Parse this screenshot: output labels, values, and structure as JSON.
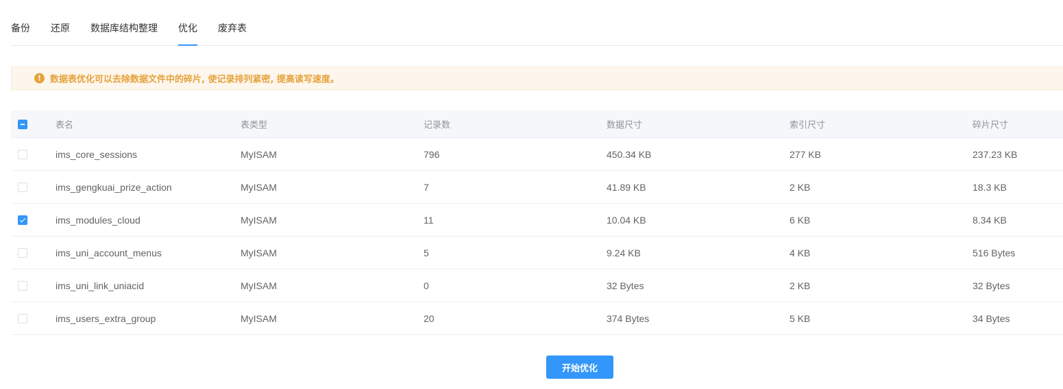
{
  "tabs": [
    {
      "label": "备份"
    },
    {
      "label": "还原"
    },
    {
      "label": "数据库结构整理"
    },
    {
      "label": "优化",
      "active": true
    },
    {
      "label": "废弃表"
    }
  ],
  "alert": {
    "icon": "!",
    "text": "数据表优化可以去除数据文件中的碎片, 使记录排列紧密, 提高读写速度。"
  },
  "table": {
    "columns": [
      "表名",
      "表类型",
      "记录数",
      "数据尺寸",
      "索引尺寸",
      "碎片尺寸"
    ],
    "rows": [
      {
        "name": "ims_core_sessions",
        "type": "MyISAM",
        "records": "796",
        "data_size": "450.34 KB",
        "index_size": "277 KB",
        "fragment_size": "237.23 KB",
        "checked": false
      },
      {
        "name": "ims_gengkuai_prize_action",
        "type": "MyISAM",
        "records": "7",
        "data_size": "41.89 KB",
        "index_size": "2 KB",
        "fragment_size": "18.3 KB",
        "checked": false
      },
      {
        "name": "ims_modules_cloud",
        "type": "MyISAM",
        "records": "11",
        "data_size": "10.04 KB",
        "index_size": "6 KB",
        "fragment_size": "8.34 KB",
        "checked": true
      },
      {
        "name": "ims_uni_account_menus",
        "type": "MyISAM",
        "records": "5",
        "data_size": "9.24 KB",
        "index_size": "4 KB",
        "fragment_size": "516 Bytes",
        "checked": false
      },
      {
        "name": "ims_uni_link_uniacid",
        "type": "MyISAM",
        "records": "0",
        "data_size": "32 Bytes",
        "index_size": "2 KB",
        "fragment_size": "32 Bytes",
        "checked": false
      },
      {
        "name": "ims_users_extra_group",
        "type": "MyISAM",
        "records": "20",
        "data_size": "374 Bytes",
        "index_size": "5 KB",
        "fragment_size": "34 Bytes",
        "checked": false
      }
    ]
  },
  "actions": {
    "start_label": "开始优化"
  },
  "colors": {
    "accent": "#3296fa",
    "warning": "#e6a23c",
    "warning_bg": "#fdf6ec"
  }
}
